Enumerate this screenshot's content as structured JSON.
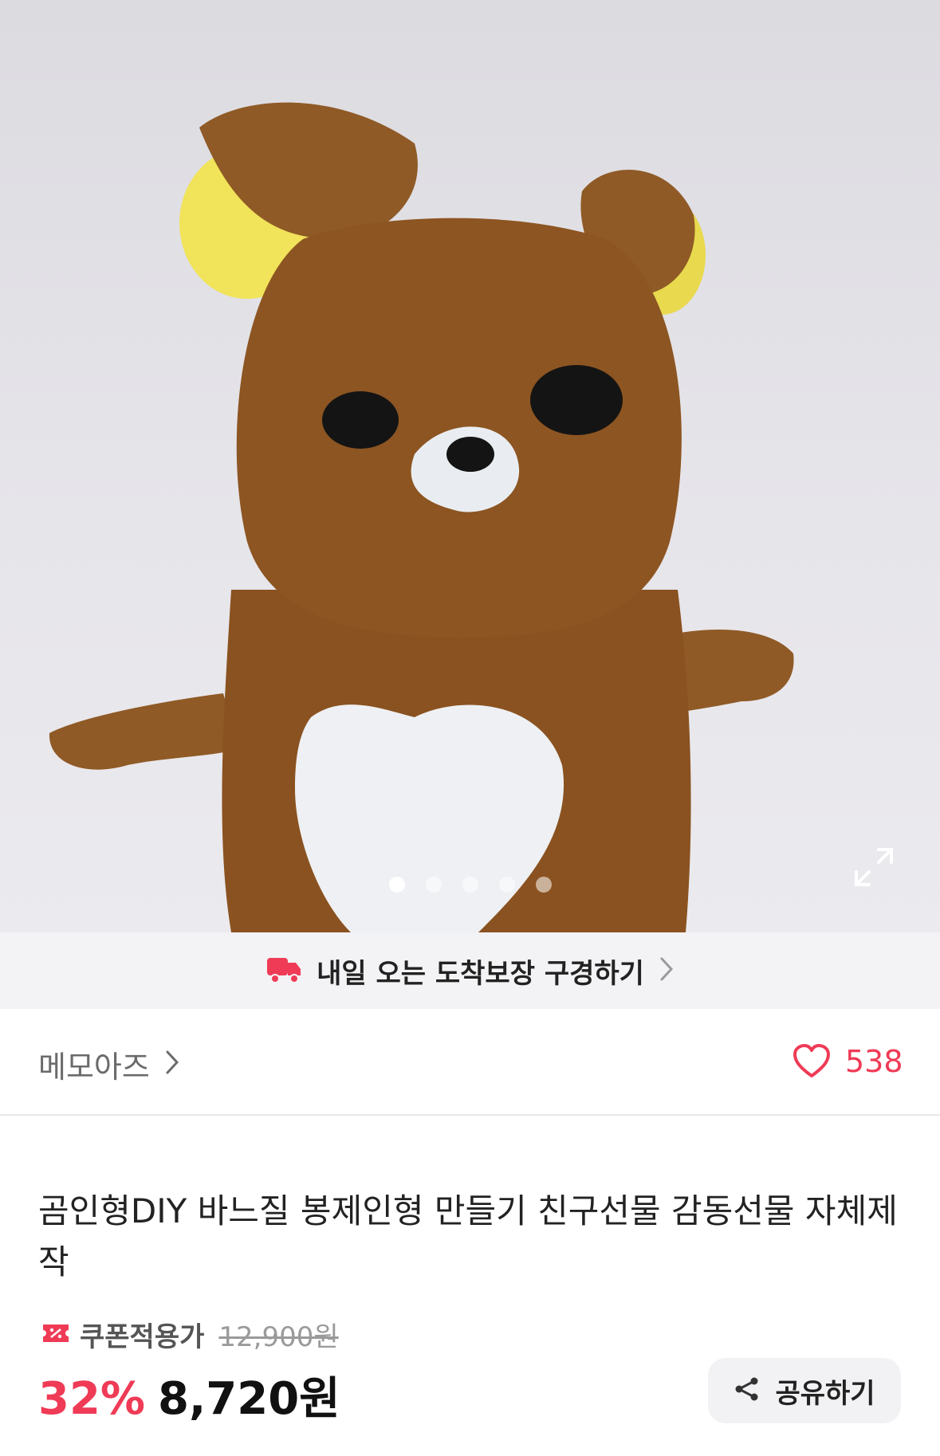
{
  "hero": {
    "image_desc": "brown plush bear",
    "slide_count": 5,
    "active_slide": 1
  },
  "delivery": {
    "text": "내일 오는 도착보장 구경하기",
    "icon": "truck-icon"
  },
  "seller": {
    "name": "메모아즈",
    "likes": "538"
  },
  "product": {
    "title": "곰인형DIY 바느질 봉제인형 만들기  친구선물 감동선물 자체제작",
    "coupon_label": "쿠폰적용가",
    "original_price": "12,900원",
    "discount": "32%",
    "price": "8,720원",
    "share_label": "공유하기"
  },
  "colors": {
    "accent": "#ef3b56",
    "bear": "#8a5220"
  }
}
